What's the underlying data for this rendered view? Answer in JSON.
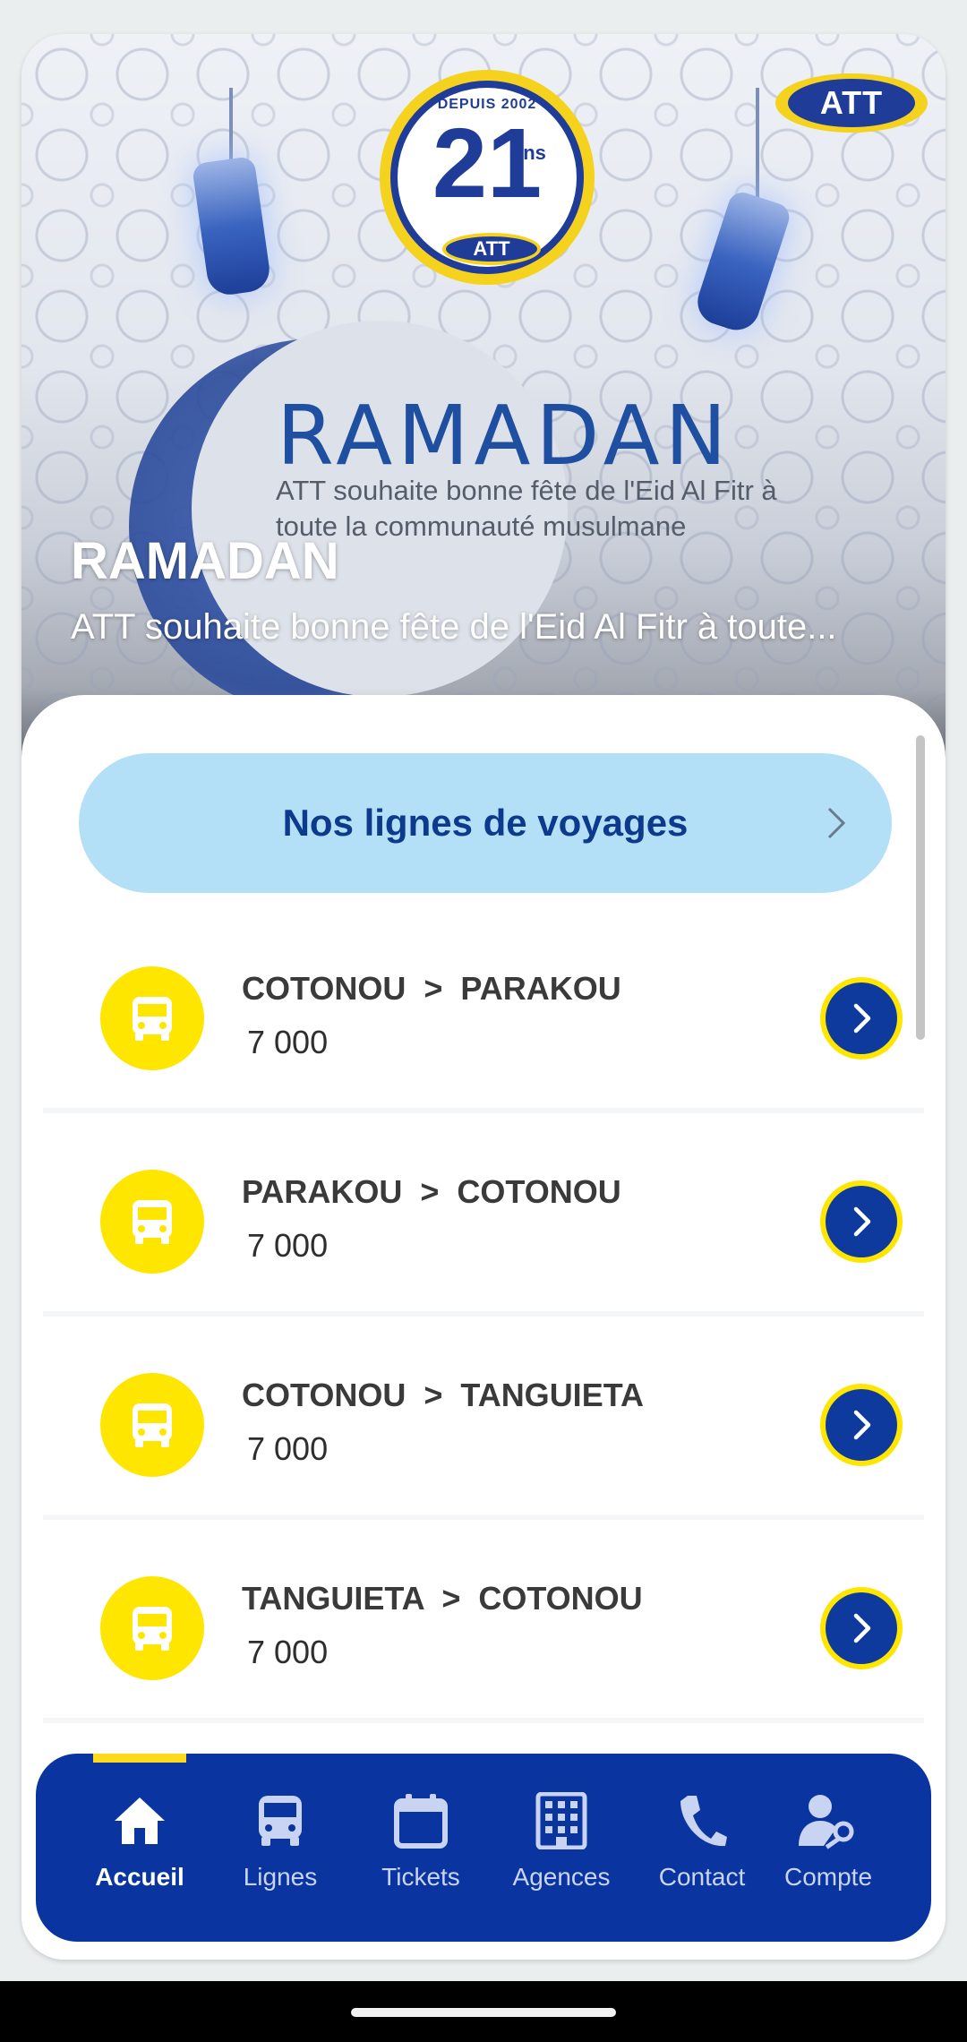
{
  "banner": {
    "title": "RAMADAN",
    "description": "ATT souhaite bonne fête de l'Eid Al Fitr à toute...",
    "image_heading": "RAMADAN",
    "image_subtext": "ATT souhaite bonne fête de l'Eid Al Fitr à toute la communauté musulmane",
    "emblem": {
      "top_text": "DEPUIS 2002",
      "number": "21",
      "suffix": "ans",
      "brand": "ATT"
    },
    "brand_logo": "ATT"
  },
  "lines_button": {
    "label": "Nos lignes de voyages",
    "icon": "chevron-right-icon"
  },
  "routes": [
    {
      "name": "COTONOU  >  PARAKOU",
      "price": "7 000"
    },
    {
      "name": "PARAKOU  >  COTONOU",
      "price": "7 000"
    },
    {
      "name": "COTONOU  >  TANGUIETA",
      "price": "7 000"
    },
    {
      "name": "TANGUIETA  >  COTONOU",
      "price": "7 000"
    }
  ],
  "nav": {
    "items": [
      {
        "label": "Accueil",
        "icon": "home-icon",
        "active": true
      },
      {
        "label": "Lignes",
        "icon": "bus-icon",
        "active": false
      },
      {
        "label": "Tickets",
        "icon": "calendar-icon",
        "active": false
      },
      {
        "label": "Agences",
        "icon": "building-icon",
        "active": false
      },
      {
        "label": "Contact",
        "icon": "phone-icon",
        "active": false
      },
      {
        "label": "Compte",
        "icon": "user-key-icon",
        "active": false
      }
    ]
  },
  "colors": {
    "brand_blue": "#0a34a0",
    "brand_yellow": "#ffe600",
    "button_light_blue": "#b3e0f7",
    "button_text": "#0d3a8c"
  }
}
